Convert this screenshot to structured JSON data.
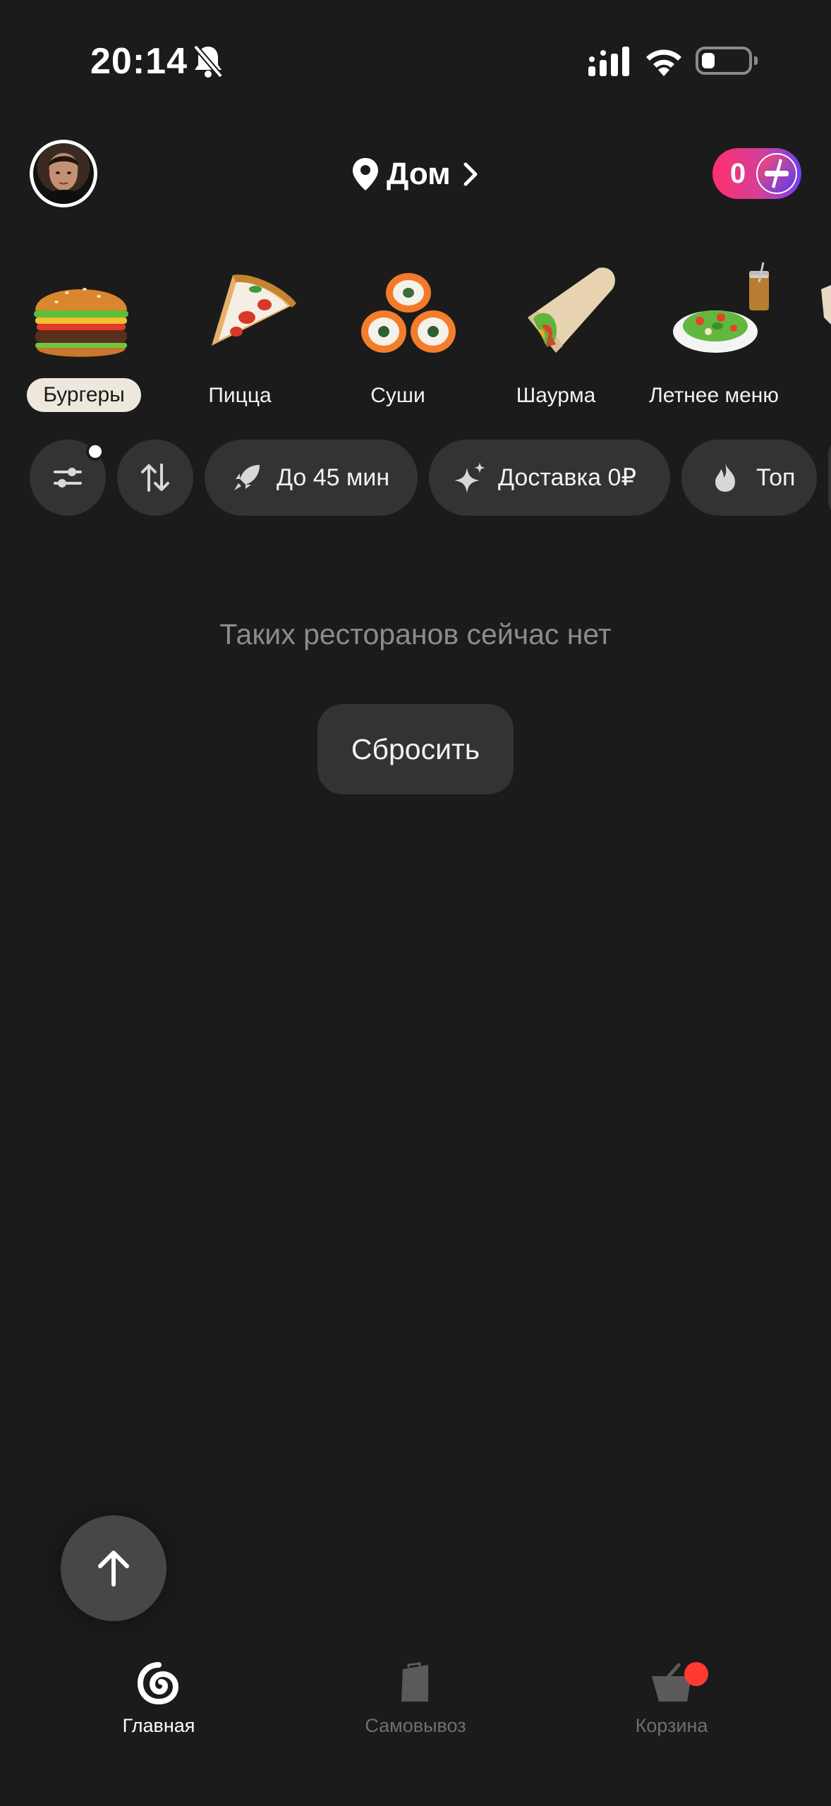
{
  "status_bar": {
    "time": "20:14",
    "icons": [
      "bell-off-icon",
      "signal-icon",
      "wifi-icon",
      "battery-icon"
    ]
  },
  "header": {
    "location_label": "Дом",
    "plus_points": "0",
    "icons": [
      "avatar",
      "pin-icon",
      "chevron-right-icon",
      "plus-icon"
    ]
  },
  "categories": [
    {
      "label": "Бургеры",
      "selected": true,
      "icon": "burger-image"
    },
    {
      "label": "Пицца",
      "selected": false,
      "icon": "pizza-image"
    },
    {
      "label": "Суши",
      "selected": false,
      "icon": "sushi-image"
    },
    {
      "label": "Шаурма",
      "selected": false,
      "icon": "shawarma-image"
    },
    {
      "label": "Летнее меню",
      "selected": false,
      "icon": "salad-image"
    }
  ],
  "filters": {
    "delivery_time": "До 45 мин",
    "free_delivery": "Доставка 0₽",
    "top": "Топ",
    "icons": [
      "settings-sliders-icon",
      "sort-icon",
      "rocket-icon",
      "sparkle-icon",
      "flame-icon"
    ]
  },
  "empty_state": {
    "message": "Таких ресторанов сейчас нет",
    "reset_label": "Сбросить"
  },
  "tabbar": {
    "items": [
      {
        "label": "Главная",
        "active": true,
        "icon": "home-swirl-icon"
      },
      {
        "label": "Самовывоз",
        "active": false,
        "icon": "bag-icon"
      },
      {
        "label": "Корзина",
        "active": false,
        "icon": "cart-icon"
      }
    ]
  },
  "colors": {
    "background": "#1b1b1b",
    "chip": "#333333",
    "selected_category": "#ede8db",
    "plus_gradient_start": "#ff2f6d",
    "plus_gradient_end": "#6f3ff5",
    "cart_badge": "#ff3b30"
  }
}
